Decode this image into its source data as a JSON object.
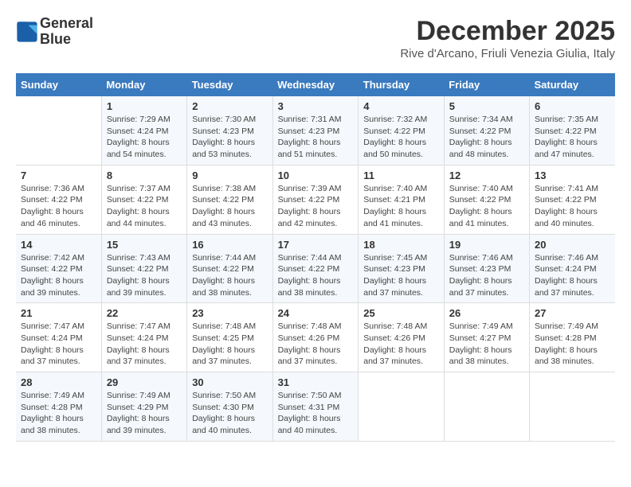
{
  "logo": {
    "line1": "General",
    "line2": "Blue"
  },
  "title": "December 2025",
  "location": "Rive d'Arcano, Friuli Venezia Giulia, Italy",
  "weekdays": [
    "Sunday",
    "Monday",
    "Tuesday",
    "Wednesday",
    "Thursday",
    "Friday",
    "Saturday"
  ],
  "weeks": [
    [
      {
        "day": "",
        "info": ""
      },
      {
        "day": "1",
        "info": "Sunrise: 7:29 AM\nSunset: 4:24 PM\nDaylight: 8 hours\nand 54 minutes."
      },
      {
        "day": "2",
        "info": "Sunrise: 7:30 AM\nSunset: 4:23 PM\nDaylight: 8 hours\nand 53 minutes."
      },
      {
        "day": "3",
        "info": "Sunrise: 7:31 AM\nSunset: 4:23 PM\nDaylight: 8 hours\nand 51 minutes."
      },
      {
        "day": "4",
        "info": "Sunrise: 7:32 AM\nSunset: 4:22 PM\nDaylight: 8 hours\nand 50 minutes."
      },
      {
        "day": "5",
        "info": "Sunrise: 7:34 AM\nSunset: 4:22 PM\nDaylight: 8 hours\nand 48 minutes."
      },
      {
        "day": "6",
        "info": "Sunrise: 7:35 AM\nSunset: 4:22 PM\nDaylight: 8 hours\nand 47 minutes."
      }
    ],
    [
      {
        "day": "7",
        "info": "Sunrise: 7:36 AM\nSunset: 4:22 PM\nDaylight: 8 hours\nand 46 minutes."
      },
      {
        "day": "8",
        "info": "Sunrise: 7:37 AM\nSunset: 4:22 PM\nDaylight: 8 hours\nand 44 minutes."
      },
      {
        "day": "9",
        "info": "Sunrise: 7:38 AM\nSunset: 4:22 PM\nDaylight: 8 hours\nand 43 minutes."
      },
      {
        "day": "10",
        "info": "Sunrise: 7:39 AM\nSunset: 4:22 PM\nDaylight: 8 hours\nand 42 minutes."
      },
      {
        "day": "11",
        "info": "Sunrise: 7:40 AM\nSunset: 4:21 PM\nDaylight: 8 hours\nand 41 minutes."
      },
      {
        "day": "12",
        "info": "Sunrise: 7:40 AM\nSunset: 4:22 PM\nDaylight: 8 hours\nand 41 minutes."
      },
      {
        "day": "13",
        "info": "Sunrise: 7:41 AM\nSunset: 4:22 PM\nDaylight: 8 hours\nand 40 minutes."
      }
    ],
    [
      {
        "day": "14",
        "info": "Sunrise: 7:42 AM\nSunset: 4:22 PM\nDaylight: 8 hours\nand 39 minutes."
      },
      {
        "day": "15",
        "info": "Sunrise: 7:43 AM\nSunset: 4:22 PM\nDaylight: 8 hours\nand 39 minutes."
      },
      {
        "day": "16",
        "info": "Sunrise: 7:44 AM\nSunset: 4:22 PM\nDaylight: 8 hours\nand 38 minutes."
      },
      {
        "day": "17",
        "info": "Sunrise: 7:44 AM\nSunset: 4:22 PM\nDaylight: 8 hours\nand 38 minutes."
      },
      {
        "day": "18",
        "info": "Sunrise: 7:45 AM\nSunset: 4:23 PM\nDaylight: 8 hours\nand 37 minutes."
      },
      {
        "day": "19",
        "info": "Sunrise: 7:46 AM\nSunset: 4:23 PM\nDaylight: 8 hours\nand 37 minutes."
      },
      {
        "day": "20",
        "info": "Sunrise: 7:46 AM\nSunset: 4:24 PM\nDaylight: 8 hours\nand 37 minutes."
      }
    ],
    [
      {
        "day": "21",
        "info": "Sunrise: 7:47 AM\nSunset: 4:24 PM\nDaylight: 8 hours\nand 37 minutes."
      },
      {
        "day": "22",
        "info": "Sunrise: 7:47 AM\nSunset: 4:24 PM\nDaylight: 8 hours\nand 37 minutes."
      },
      {
        "day": "23",
        "info": "Sunrise: 7:48 AM\nSunset: 4:25 PM\nDaylight: 8 hours\nand 37 minutes."
      },
      {
        "day": "24",
        "info": "Sunrise: 7:48 AM\nSunset: 4:26 PM\nDaylight: 8 hours\nand 37 minutes."
      },
      {
        "day": "25",
        "info": "Sunrise: 7:48 AM\nSunset: 4:26 PM\nDaylight: 8 hours\nand 37 minutes."
      },
      {
        "day": "26",
        "info": "Sunrise: 7:49 AM\nSunset: 4:27 PM\nDaylight: 8 hours\nand 38 minutes."
      },
      {
        "day": "27",
        "info": "Sunrise: 7:49 AM\nSunset: 4:28 PM\nDaylight: 8 hours\nand 38 minutes."
      }
    ],
    [
      {
        "day": "28",
        "info": "Sunrise: 7:49 AM\nSunset: 4:28 PM\nDaylight: 8 hours\nand 38 minutes."
      },
      {
        "day": "29",
        "info": "Sunrise: 7:49 AM\nSunset: 4:29 PM\nDaylight: 8 hours\nand 39 minutes."
      },
      {
        "day": "30",
        "info": "Sunrise: 7:50 AM\nSunset: 4:30 PM\nDaylight: 8 hours\nand 40 minutes."
      },
      {
        "day": "31",
        "info": "Sunrise: 7:50 AM\nSunset: 4:31 PM\nDaylight: 8 hours\nand 40 minutes."
      },
      {
        "day": "",
        "info": ""
      },
      {
        "day": "",
        "info": ""
      },
      {
        "day": "",
        "info": ""
      }
    ]
  ]
}
